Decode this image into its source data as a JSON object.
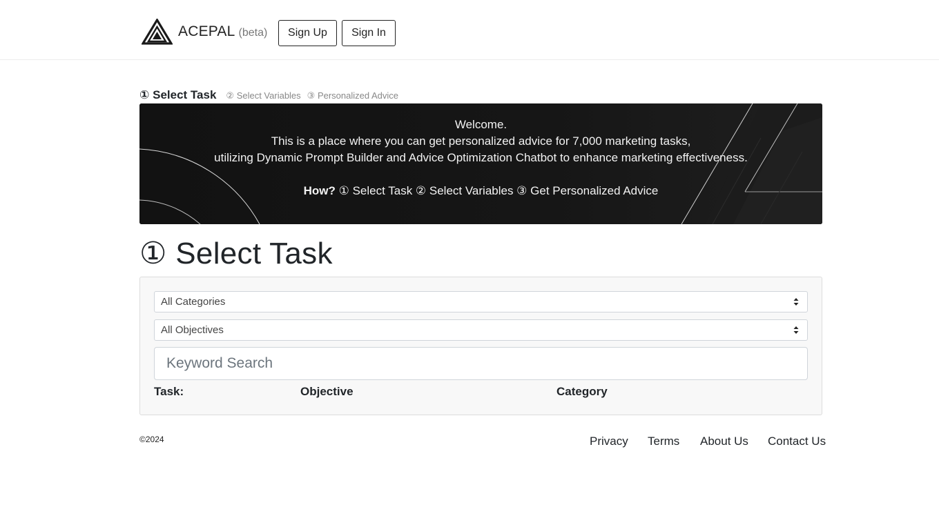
{
  "header": {
    "logo_icon": "acepal-triangle-logo-icon",
    "brand_name": "ACEPAL",
    "brand_tag": "(beta)",
    "signup_label": "Sign Up",
    "signin_label": "Sign In"
  },
  "steps": {
    "active": "① Select Task",
    "step2": "② Select Variables",
    "step3": "③ Personalized Advice"
  },
  "hero": {
    "line1": "Welcome.",
    "line2": "This is a place where you can get personalized advice for 7,000 marketing tasks,",
    "line3": "utilizing Dynamic Prompt Builder and Advice Optimization Chatbot to enhance marketing effectiveness.",
    "how_label": "How?",
    "how_steps": " ① Select Task ② Select Variables ③ Get Personalized Advice"
  },
  "main": {
    "title": "① Select Task",
    "category_select": {
      "value": "All Categories"
    },
    "objective_select": {
      "value": "All Objectives"
    },
    "search": {
      "placeholder": "Keyword Search",
      "value": ""
    },
    "columns": [
      "Task:",
      "Objective",
      "Category"
    ]
  },
  "footer": {
    "copyright": "©2024",
    "links": [
      "Privacy",
      "Terms",
      "About Us",
      "Contact Us"
    ]
  },
  "colors": {
    "hero_bg": "#141414",
    "panel_bg": "#f8f8f8",
    "text": "#212529",
    "muted": "#888888"
  }
}
